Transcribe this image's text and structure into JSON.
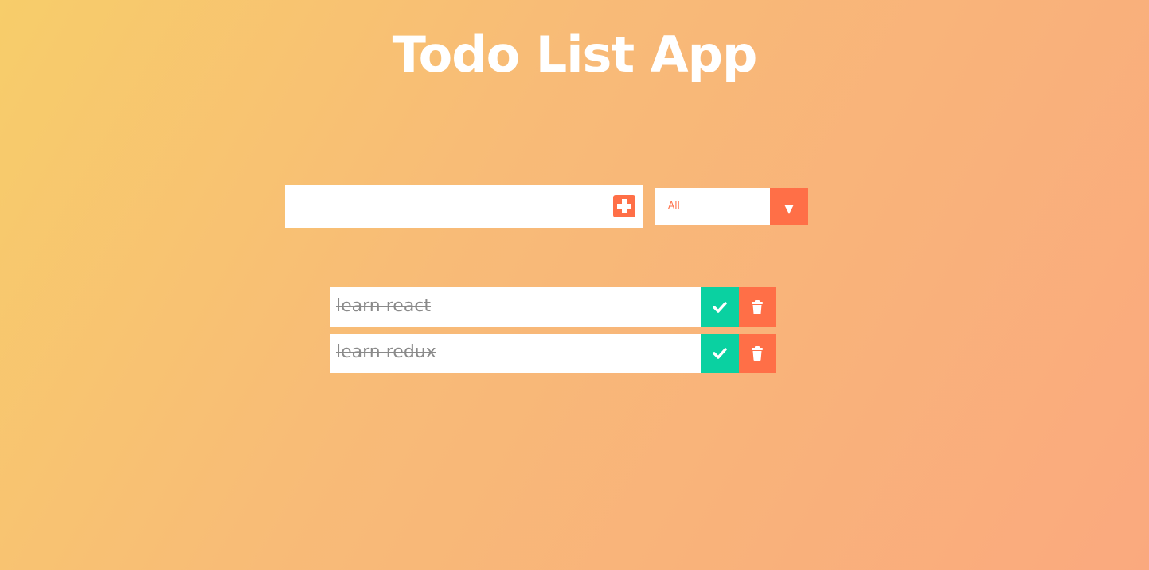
{
  "app": {
    "title": "Todo List App"
  },
  "form": {
    "input_value": "",
    "add_icon": "plus-square-icon"
  },
  "filter": {
    "selected": "All",
    "arrow": "▼",
    "arrow_icon": "caret-down-icon"
  },
  "todos": [
    {
      "text": "learn react",
      "completed": true,
      "check_icon": "check-icon",
      "delete_icon": "trash-icon"
    },
    {
      "text": "learn redux",
      "completed": true,
      "check_icon": "check-icon",
      "delete_icon": "trash-icon"
    }
  ],
  "colors": {
    "accent": "#ff6f47",
    "complete": "#0ad1a1",
    "background_start": "#f7cd6a",
    "background_end": "#faa97e",
    "completed_text": "#8a8a8a"
  }
}
